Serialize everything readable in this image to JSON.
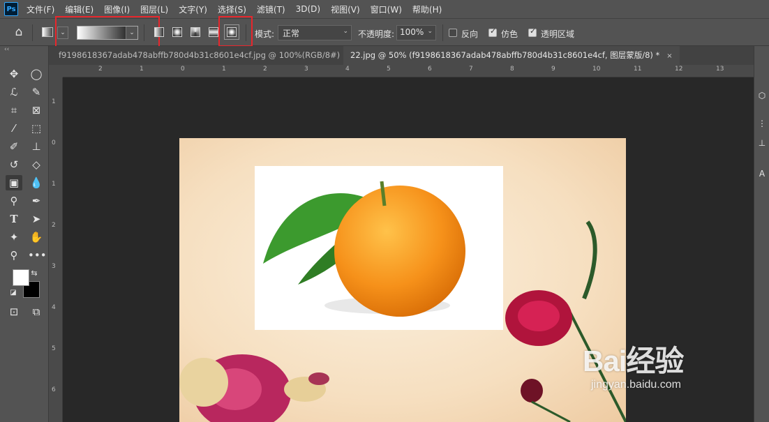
{
  "app": {
    "logo": "Ps"
  },
  "menu": [
    "文件(F)",
    "编辑(E)",
    "图像(I)",
    "图层(L)",
    "文字(Y)",
    "选择(S)",
    "滤镜(T)",
    "3D(D)",
    "视图(V)",
    "窗口(W)",
    "帮助(H)"
  ],
  "options": {
    "mode_label": "模式:",
    "mode_value": "正常",
    "opacity_label": "不透明度:",
    "opacity_value": "100%",
    "reverse_label": "反向",
    "reverse_checked": false,
    "dither_label": "仿色",
    "dither_checked": true,
    "transparency_label": "透明区域",
    "transparency_checked": true,
    "gradient_types": [
      "linear",
      "radial",
      "angle",
      "reflected",
      "diamond"
    ],
    "selected_gradient_type": "diamond",
    "gradient_preset": {
      "from": "#ffffff",
      "to": "#000000"
    }
  },
  "tabs": [
    {
      "label": "f9198618367adab478abffb780d4b31c8601e4cf.jpg @ 100%(RGB/8#)",
      "close": "×"
    },
    {
      "label": "22.jpg @ 50% (f9198618367adab478abffb780d4b31c8601e4cf, 图层蒙版/8) *",
      "close": "×"
    }
  ],
  "rulers": {
    "horizontal": [
      "2",
      "1",
      "0",
      "1",
      "2",
      "3",
      "4",
      "5",
      "6",
      "7",
      "8",
      "9",
      "10",
      "11",
      "12",
      "13"
    ],
    "vertical": [
      "1",
      "0",
      "1",
      "2",
      "3",
      "4",
      "5",
      "6",
      "7"
    ]
  },
  "tools": [
    "move-tool",
    "marquee-tool",
    "lasso-tool",
    "quick-select-tool",
    "crop-tool",
    "frame-tool",
    "eyedropper-tool",
    "patch-tool",
    "brush-tool",
    "stamp-tool",
    "history-brush-tool",
    "eraser-tool",
    "gradient-tool",
    "blur-tool",
    "dodge-tool",
    "pen-tool",
    "type-tool",
    "path-select-tool",
    "shape-tool",
    "hand-tool",
    "zoom-tool",
    "more-tools"
  ],
  "colors": {
    "foreground": "#ffffff",
    "background": "#000000",
    "highlight": "#e8262c"
  },
  "watermark": {
    "brand": "Bai经验",
    "url": "jingyan.baidu.com"
  }
}
